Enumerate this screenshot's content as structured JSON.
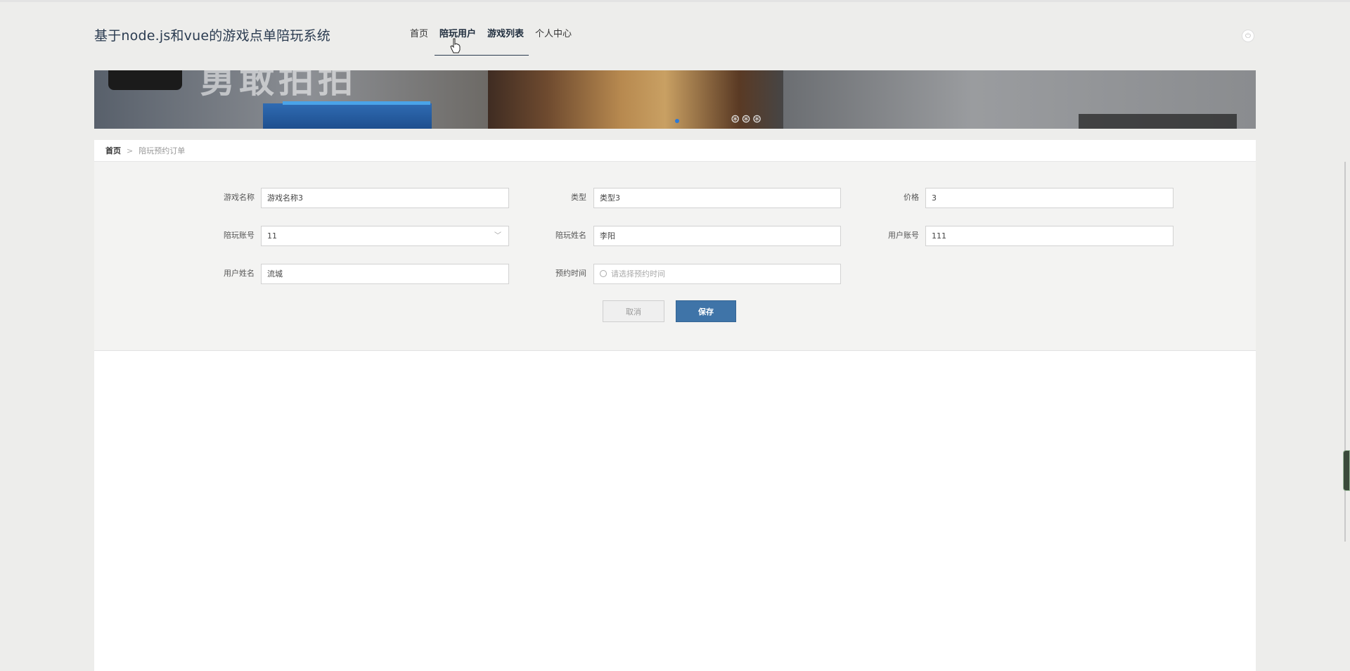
{
  "header": {
    "site_title": "基于node.js和vue的游戏点单陪玩系统",
    "nav": [
      {
        "label": "首页"
      },
      {
        "label": "陪玩用户"
      },
      {
        "label": "游戏列表"
      },
      {
        "label": "个人中心"
      }
    ],
    "power_icon": "power-icon"
  },
  "banner": {
    "emblems": "⊛⊛⊛"
  },
  "breadcrumb": {
    "home": "首页",
    "separator": ">",
    "current": "陪玩预约订单"
  },
  "form": {
    "game_name": {
      "label": "游戏名称",
      "value": "游戏名称3"
    },
    "type": {
      "label": "类型",
      "value": "类型3"
    },
    "price": {
      "label": "价格",
      "value": "3"
    },
    "companion_account": {
      "label": "陪玩账号",
      "value": "11"
    },
    "companion_name": {
      "label": "陪玩姓名",
      "value": "李阳"
    },
    "user_account": {
      "label": "用户账号",
      "value": "111"
    },
    "user_name": {
      "label": "用户姓名",
      "value": "流城"
    },
    "appointment_time": {
      "label": "预约时间",
      "placeholder": "请选择预约时间"
    }
  },
  "buttons": {
    "cancel": "取消",
    "save": "保存"
  },
  "colors": {
    "accent": "#3f74a8",
    "background": "#ededeb",
    "title": "#2a3b50"
  }
}
